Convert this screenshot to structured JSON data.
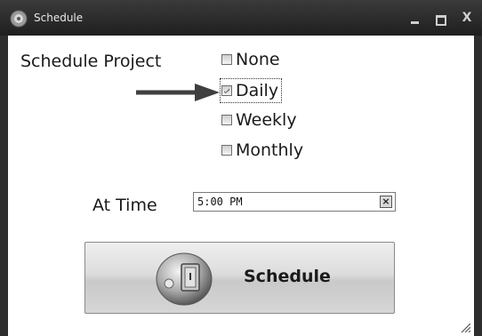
{
  "window": {
    "title": "Schedule",
    "close_label": "X"
  },
  "form": {
    "schedule_project_label": "Schedule Project",
    "options": [
      {
        "label": "None",
        "checked": false
      },
      {
        "label": "Daily",
        "checked": true
      },
      {
        "label": "Weekly",
        "checked": false
      },
      {
        "label": "Monthly",
        "checked": false
      }
    ],
    "at_time_label": "At Time",
    "time_value": "5:00 PM",
    "clear_label": "×"
  },
  "actions": {
    "schedule_label": "Schedule"
  },
  "colors": {
    "titlebar": "#2a2a2a",
    "arrow": "#3f3f3f"
  }
}
